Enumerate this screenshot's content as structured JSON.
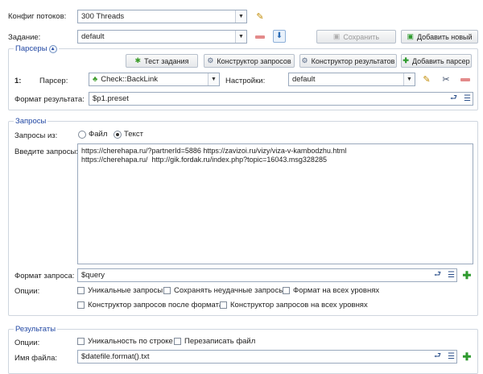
{
  "config": {
    "label": "Конфиг потоков:",
    "value": "300 Threads"
  },
  "task": {
    "label": "Задание:",
    "value": "default",
    "save_label": "Сохранить",
    "add_new_label": "Добавить новый"
  },
  "parsers": {
    "legend": "Парсеры",
    "test_task_label": "Тест задания",
    "query_builder_label": "Конструктор запросов",
    "result_builder_label": "Конструктор результатов",
    "add_parser_label": "Добавить парсер",
    "index": "1:",
    "parser_label": "Парсер:",
    "parser_value": "Check::BackLink",
    "settings_label": "Настройки:",
    "settings_value": "default",
    "result_format_label": "Формат результата:",
    "result_format_value": "$p1.preset"
  },
  "queries": {
    "legend": "Запросы",
    "source_label": "Запросы из:",
    "source_file": "Файл",
    "source_text": "Текст",
    "enter_label": "Введите запросы:",
    "text": "https://cherehapa.ru/?partnerId=5886 https://zavizoi.ru/vizy/viza-v-kambodzhu.html\nhttps://cherehapa.ru/  http://gik.fordak.ru/index.php?topic=16043.msg328285",
    "format_label": "Формат запроса:",
    "format_value": "$query",
    "options_label": "Опции:",
    "opt_unique": "Уникальные запросы",
    "opt_save_failed": "Сохранять неудачные запросы",
    "opt_format_all_levels": "Формат на всех уровнях",
    "opt_builder_after_format": "Конструктор запросов после формата",
    "opt_builder_all_levels": "Конструктор запросов на всех уровнях"
  },
  "results": {
    "legend": "Результаты",
    "options_label": "Опции:",
    "opt_unique_line": "Уникальность по строке",
    "opt_overwrite": "Перезаписать файл",
    "filename_label": "Имя файла:",
    "filename_value": "$datefile.format().txt"
  },
  "colors": {
    "legend": "#2147a3",
    "border": "#9aa9bd",
    "add": "#2e9a2e",
    "remove": "#e05050"
  }
}
